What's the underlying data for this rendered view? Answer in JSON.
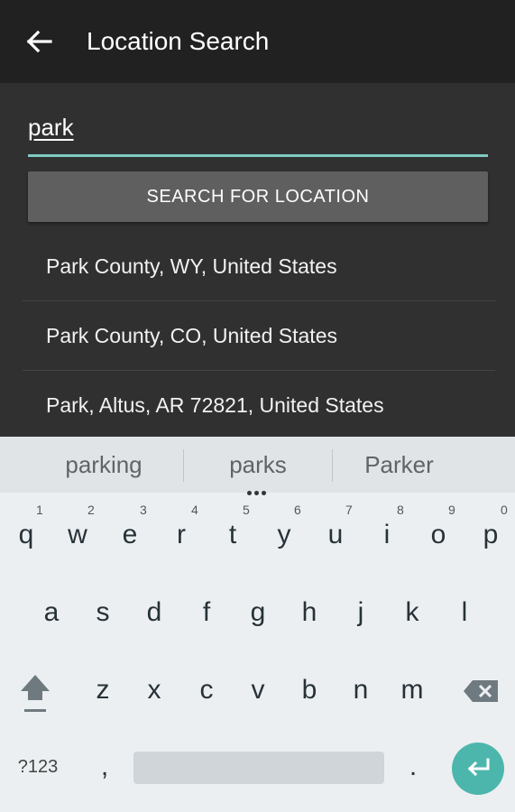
{
  "appbar": {
    "title": "Location Search",
    "back_icon": "arrow-left-icon"
  },
  "search": {
    "value": "park",
    "button_label": "SEARCH FOR LOCATION"
  },
  "results": [
    "Park County, WY, United States",
    "Park County, CO, United States",
    "Park, Altus, AR 72821, United States"
  ],
  "keyboard": {
    "suggestions": [
      "parking",
      "parks",
      "Parker"
    ],
    "row1": [
      "q",
      "w",
      "e",
      "r",
      "t",
      "y",
      "u",
      "i",
      "o",
      "p"
    ],
    "row1_hints": [
      "1",
      "2",
      "3",
      "4",
      "5",
      "6",
      "7",
      "8",
      "9",
      "0"
    ],
    "row2": [
      "a",
      "s",
      "d",
      "f",
      "g",
      "h",
      "j",
      "k",
      "l"
    ],
    "row3": [
      "z",
      "x",
      "c",
      "v",
      "b",
      "n",
      "m"
    ],
    "symbols_label": "?123",
    "comma": ",",
    "period": ".",
    "accent_color": "#4db6ac",
    "shift_icon": "shift-icon",
    "backspace_icon": "backspace-icon",
    "enter_icon": "enter-icon"
  },
  "colors": {
    "appbar": "#212121",
    "background": "#303030",
    "input_underline": "#80cbc4"
  }
}
